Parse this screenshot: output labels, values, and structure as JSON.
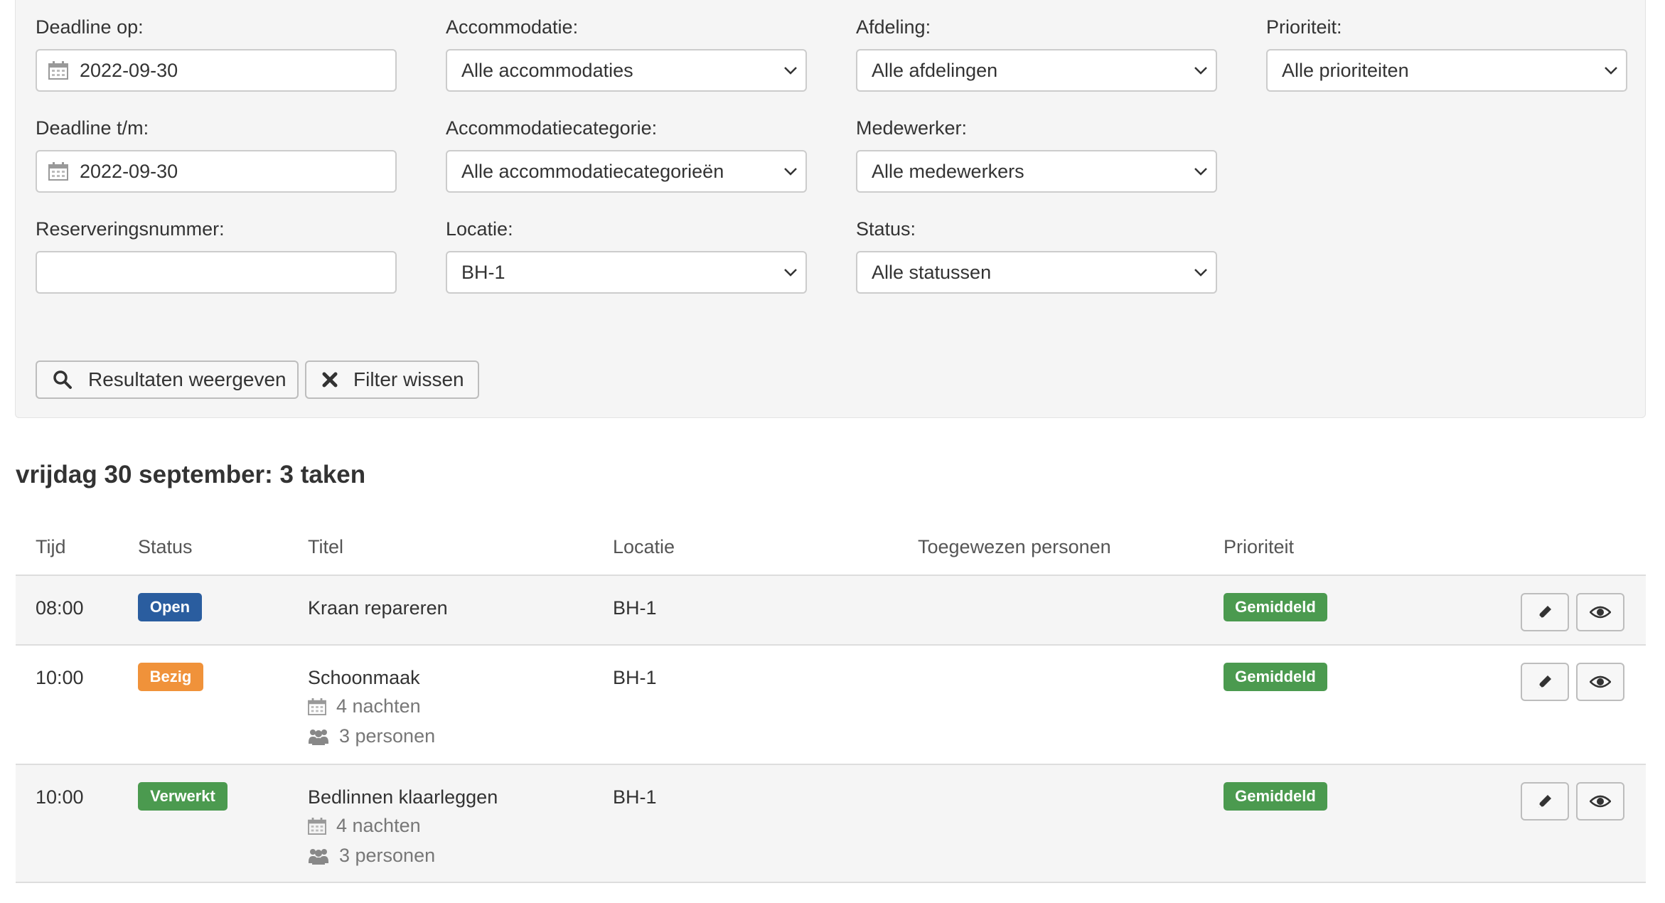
{
  "filters": {
    "deadline_from": {
      "label": "Deadline op:",
      "value": "2022-09-30"
    },
    "deadline_to": {
      "label": "Deadline t/m:",
      "value": "2022-09-30"
    },
    "reservation_number": {
      "label": "Reserveringsnummer:",
      "value": ""
    },
    "accommodation": {
      "label": "Accommodatie:",
      "value": "Alle accommodaties"
    },
    "accommodation_category": {
      "label": "Accommodatiecategorie:",
      "value": "Alle accommodatiecategorieën"
    },
    "location": {
      "label": "Locatie:",
      "value": "BH-1"
    },
    "department": {
      "label": "Afdeling:",
      "value": "Alle afdelingen"
    },
    "employee": {
      "label": "Medewerker:",
      "value": "Alle medewerkers"
    },
    "status": {
      "label": "Status:",
      "value": "Alle statussen"
    },
    "priority": {
      "label": "Prioriteit:",
      "value": "Alle prioriteiten"
    },
    "show_results_label": "Resultaten weergeven",
    "clear_filter_label": "Filter wissen"
  },
  "day_heading": "vrijdag 30 september: 3 taken",
  "table": {
    "headers": {
      "time": "Tijd",
      "status": "Status",
      "title": "Titel",
      "location": "Locatie",
      "assigned": "Toegewezen personen",
      "priority": "Prioriteit"
    },
    "rows": [
      {
        "time": "08:00",
        "status": "Open",
        "title": "Kraan repareren",
        "location": "BH-1",
        "assigned": "",
        "priority": "Gemiddeld",
        "nights": "",
        "persons": ""
      },
      {
        "time": "10:00",
        "status": "Bezig",
        "title": "Schoonmaak",
        "location": "BH-1",
        "assigned": "",
        "priority": "Gemiddeld",
        "nights": "4 nachten",
        "persons": "3 personen"
      },
      {
        "time": "10:00",
        "status": "Verwerkt",
        "title": "Bedlinnen klaarleggen",
        "location": "BH-1",
        "assigned": "",
        "priority": "Gemiddeld",
        "nights": "4 nachten",
        "persons": "3 personen"
      }
    ]
  },
  "colors": {
    "status_open": "#2a5d9f",
    "status_bezig": "#f0923a",
    "status_verwerkt": "#4b9a4f",
    "priority_gemiddeld": "#4b9a4f"
  },
  "icons": {
    "date_field": "calendar-icon",
    "select_field": "chevron-down-icon",
    "show_results": "search-icon",
    "clear_filter": "times-icon",
    "nights": "calendar-icon",
    "persons": "users-icon",
    "edit": "pencil-icon",
    "view": "eye-icon"
  }
}
